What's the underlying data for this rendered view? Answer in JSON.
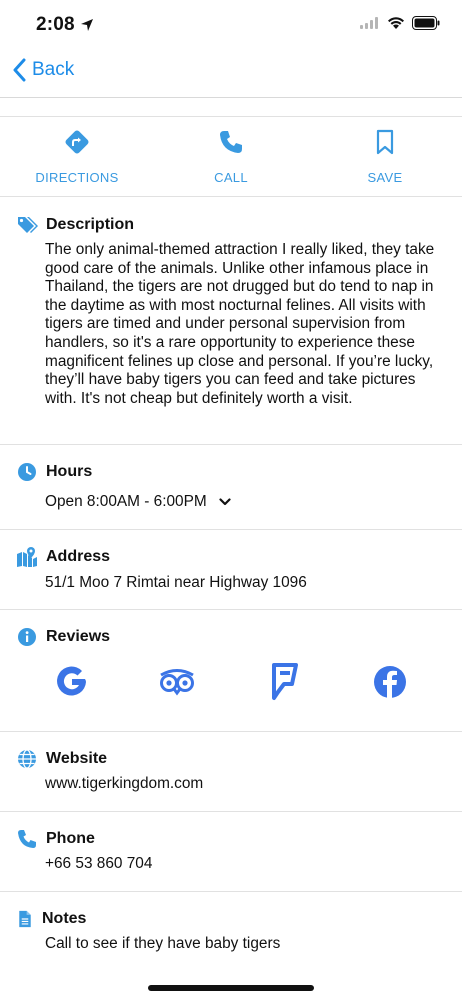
{
  "status_bar": {
    "time": "2:08"
  },
  "nav": {
    "back_label": "Back"
  },
  "actions": [
    {
      "label": "DIRECTIONS",
      "icon": "directions-icon"
    },
    {
      "label": "CALL",
      "icon": "phone-icon"
    },
    {
      "label": "SAVE",
      "icon": "bookmark-icon"
    }
  ],
  "description": {
    "title": "Description",
    "text": "The only animal-themed attraction I really liked, they take good care of the animals. Unlike other infamous place in Thailand, the tigers are not drugged but do tend to nap in the daytime as with most nocturnal felines. All visits with tigers are timed and under personal supervision from handlers, so it's a rare opportunity to experience these magnificent felines up close and personal. If you’re lucky, they’ll have baby tigers you can feed and take pictures with. It's not cheap but definitely worth a visit."
  },
  "hours": {
    "title": "Hours",
    "value": "Open 8:00AM - 6:00PM"
  },
  "address": {
    "title": "Address",
    "value": "51/1 Moo 7 Rimtai near Highway 1096"
  },
  "reviews": {
    "title": "Reviews",
    "sources": [
      "google-icon",
      "tripadvisor-icon",
      "foursquare-icon",
      "facebook-icon"
    ]
  },
  "website": {
    "title": "Website",
    "value": "www.tigerkingdom.com"
  },
  "phone": {
    "title": "Phone",
    "value": "+66 53 860 704"
  },
  "notes": {
    "title": "Notes",
    "value": "Call to see if they have baby tigers"
  },
  "colors": {
    "accent": "#1d8ce8",
    "icon_blue": "#3a9ae0",
    "review_blue": "#3b74e6"
  }
}
